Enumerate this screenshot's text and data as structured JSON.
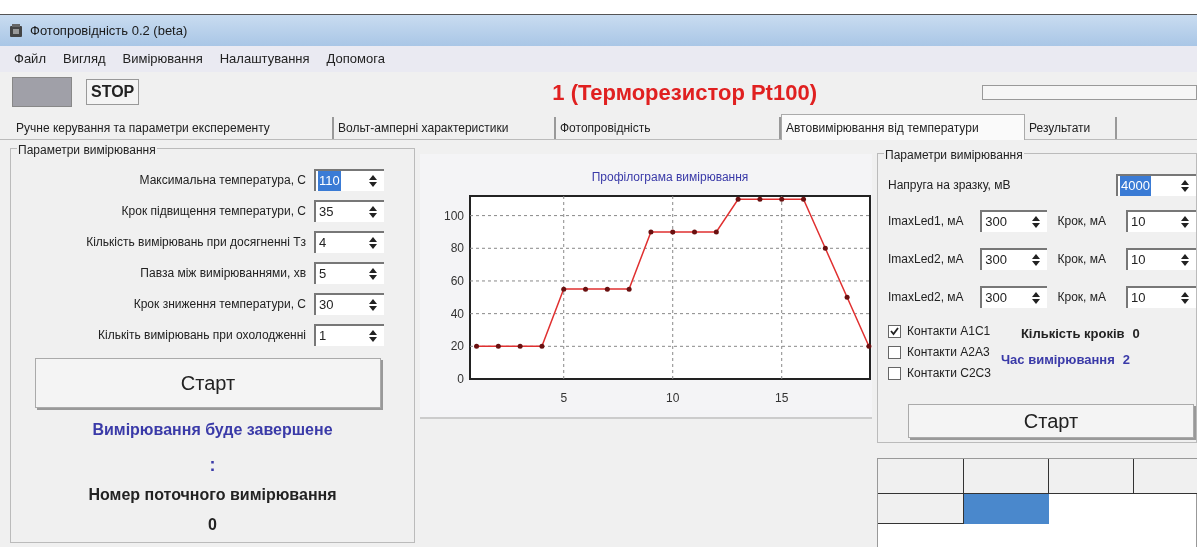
{
  "window": {
    "title": "Фотопровідність 0.2 (beta)"
  },
  "menu": [
    "Файл",
    "Вигляд",
    "Вимірювання",
    "Налаштування",
    "Допомога"
  ],
  "toolbar": {
    "stop_button": "STOP",
    "heading": "1 (Терморезистор Pt100)",
    "progress": {
      "level": 0
    }
  },
  "tabs": [
    {
      "label": "Ручне керування та параметри експеременту",
      "selected": false
    },
    {
      "label": "Вольт-амперні характеристики",
      "selected": false
    },
    {
      "label": "Фотопровідність",
      "selected": false
    },
    {
      "label": "Автовимірювання від температури",
      "selected": true
    },
    {
      "label": "Результати",
      "selected": false
    }
  ],
  "left_panel": {
    "legend": "Параметри вимірювання",
    "fields": [
      {
        "label": "Максимальна температура, С",
        "value": "110",
        "highlighted": true
      },
      {
        "label": "Крок підвищення температури, С",
        "value": "35",
        "highlighted": false
      },
      {
        "label": "Кількість вимірювань  при досягненні Тз",
        "value": "4",
        "highlighted": false
      },
      {
        "label": "Павза між вимірюваннями, хв",
        "value": "5",
        "highlighted": false
      },
      {
        "label": "Крок зниження температури, С",
        "value": "30",
        "highlighted": false
      },
      {
        "label": "Кількіть вимірювань при охолодженні",
        "value": "1",
        "highlighted": false
      }
    ],
    "start_button": "Старт",
    "status": "Вимірювання буде завершене",
    "separator": ":",
    "current_label": "Номер поточного вимірювання",
    "current_value": "0"
  },
  "chart": {
    "chart_data": {
      "type": "line",
      "title": "Профілограма вимірювання",
      "x": [
        1,
        2,
        3,
        4,
        5,
        6,
        7,
        8,
        9,
        10,
        11,
        12,
        13,
        14,
        15,
        16,
        17,
        18,
        19
      ],
      "series": [
        {
          "color": "#e03030",
          "values": [
            20,
            20,
            20,
            20,
            55,
            55,
            55,
            55,
            90,
            90,
            90,
            90,
            110,
            110,
            110,
            110,
            80,
            50,
            20
          ]
        }
      ],
      "grid": true,
      "xlim": [
        0.7,
        19.05
      ],
      "ylim": [
        0,
        112
      ],
      "xticks": [
        5,
        10,
        15
      ],
      "yticks": [
        0,
        20,
        40,
        60,
        80,
        100
      ]
    }
  },
  "right_panel": {
    "legend": "Параметри вимірювання",
    "voltage": {
      "label": "Напруга на зразку,  мВ",
      "value": "4000",
      "highlighted": true
    },
    "leds": [
      {
        "label": "ImaxLed1, мА",
        "value": "300",
        "step_label": "Крок, мА",
        "step_value": "10"
      },
      {
        "label": "ImaxLed2, мА",
        "value": "300",
        "step_label": "Крок, мА",
        "step_value": "10"
      },
      {
        "label": "ImaxLed2, мА",
        "value": "300",
        "step_label": "Крок, мА",
        "step_value": "10"
      }
    ],
    "contacts": [
      {
        "label": "Контакти A1C1",
        "checked": true
      },
      {
        "label": "Контакти A2A3",
        "checked": false
      },
      {
        "label": "Контакти C2C3",
        "checked": false
      }
    ],
    "steps_label": "Кількість кроків",
    "steps_value": "0",
    "time_label": "Час вимірювання",
    "time_value": "2",
    "start_button": "Старт"
  }
}
